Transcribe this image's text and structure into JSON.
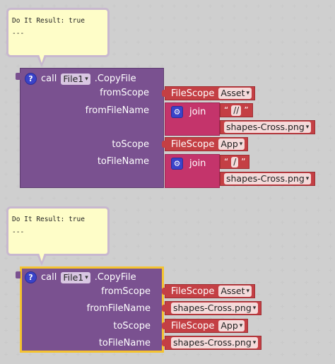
{
  "bubbles": [
    {
      "line1": "Do It Result: true",
      "line2": "---"
    },
    {
      "line1": "Do It Result: true",
      "line2": "---"
    }
  ],
  "block1": {
    "call_label": "call",
    "component": "File1",
    "method": ".CopyFile",
    "params": [
      "fromScope",
      "fromFileName",
      "toScope",
      "toFileName"
    ],
    "from_scope": {
      "label": "FileScope",
      "value": "Asset"
    },
    "from_join": {
      "label": "join",
      "text": "//",
      "file": "shapes-Cross.png"
    },
    "to_scope": {
      "label": "FileScope",
      "value": "App"
    },
    "to_join": {
      "label": "join",
      "text": "/",
      "file": "shapes-Cross.png"
    }
  },
  "block2": {
    "call_label": "call",
    "component": "File1",
    "method": ".CopyFile",
    "params": [
      "fromScope",
      "fromFileName",
      "toScope",
      "toFileName"
    ],
    "from_scope": {
      "label": "FileScope",
      "value": "Asset"
    },
    "from_file": "shapes-Cross.png",
    "to_scope": {
      "label": "FileScope",
      "value": "App"
    },
    "to_file": "shapes-Cross.png"
  },
  "glyphs": {
    "help": "?",
    "caret": "▾",
    "open_quote": "“",
    "close_quote": "”",
    "gear": "⚙"
  },
  "colors": {
    "procedure": "#7a5190",
    "scope_block": "#c43f44",
    "join_block": "#c4346b",
    "selected": "#f4c330",
    "bubble": "#fefdc8"
  }
}
